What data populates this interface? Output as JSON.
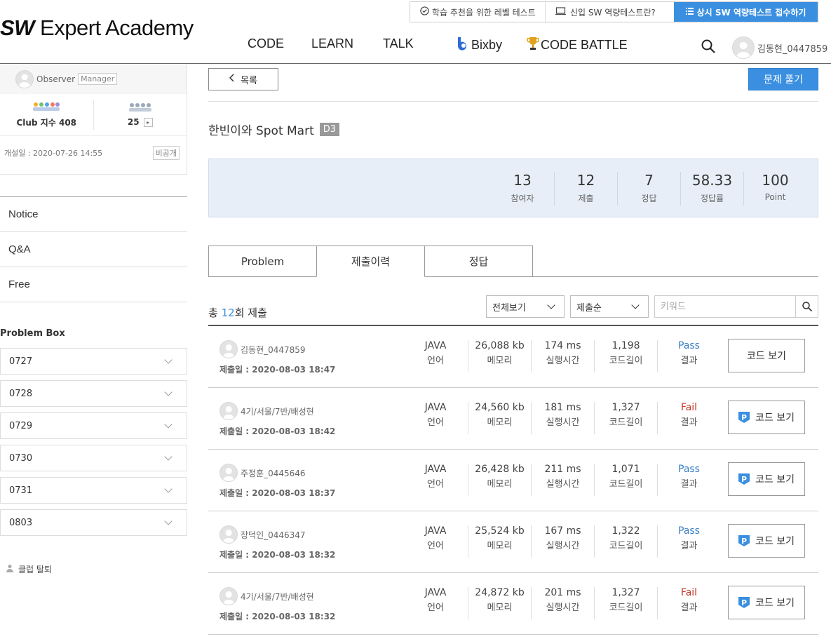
{
  "util": {
    "level_test": "학습 추천을 위한 레벨 테스트",
    "new_test": "신입 SW 역량테스트란?",
    "apply": "상시 SW 역량테스트 접수하기"
  },
  "logo": {
    "bold": "SW",
    "rest": " Expert Academy"
  },
  "nav": {
    "code": "CODE",
    "learn": "LEARN",
    "talk": "TALK",
    "bixby": "Bixby",
    "battle": "CODE BATTLE"
  },
  "user": {
    "name": "김동현_0447859"
  },
  "club": {
    "observer": "Observer",
    "manager_tag": "Manager",
    "club_index_label": "Club 지수",
    "club_index_value": "408",
    "members": "25",
    "opened": "개설일 : 2020-07-26 14:55",
    "private": "비공개"
  },
  "sidebar": {
    "links": [
      "Notice",
      "Q&A",
      "Free"
    ],
    "problem_box_title": "Problem Box",
    "boxes": [
      "0727",
      "0728",
      "0729",
      "0730",
      "0731",
      "0803"
    ],
    "leave": "클럽 탈퇴"
  },
  "main": {
    "back": "목록",
    "solve": "문제 풀기",
    "title": "한빈이와 Spot Mart",
    "level": "D3",
    "stats": [
      {
        "value": "13",
        "label": "참여자"
      },
      {
        "value": "12",
        "label": "제출"
      },
      {
        "value": "7",
        "label": "정답"
      },
      {
        "value": "58.33",
        "label": "정답률"
      },
      {
        "value": "100",
        "label": "Point"
      }
    ],
    "tabs": [
      "Problem",
      "제출이력",
      "정답"
    ],
    "count_prefix": "총",
    "count_value": "12",
    "count_suffix": "회 제출",
    "filter_all": "전체보기",
    "filter_order": "제출순",
    "keyword_placeholder": "키워드"
  },
  "labels": {
    "lang": "언어",
    "mem": "메모리",
    "time": "실행시간",
    "len": "코드길이",
    "result": "결과",
    "code_view": "코드 보기"
  },
  "submissions": [
    {
      "user": "김동현_0447859",
      "date": "제출일 : 2020-08-03 18:47",
      "lang": "JAVA",
      "mem": "26,088 kb",
      "time": "174 ms",
      "len": "1,198",
      "result": "Pass",
      "premium": false
    },
    {
      "user": "4기/서울/7반/배성현",
      "date": "제출일 : 2020-08-03 18:42",
      "lang": "JAVA",
      "mem": "24,560 kb",
      "time": "181 ms",
      "len": "1,327",
      "result": "Fail",
      "premium": true
    },
    {
      "user": "주정훈_0445646",
      "date": "제출일 : 2020-08-03 18:37",
      "lang": "JAVA",
      "mem": "26,428 kb",
      "time": "211 ms",
      "len": "1,071",
      "result": "Pass",
      "premium": true
    },
    {
      "user": "장덕인_0446347",
      "date": "제출일 : 2020-08-03 18:32",
      "lang": "JAVA",
      "mem": "25,524 kb",
      "time": "167 ms",
      "len": "1,322",
      "result": "Pass",
      "premium": true
    },
    {
      "user": "4기/서울/7반/배성현",
      "date": "제출일 : 2020-08-03 18:32",
      "lang": "JAVA",
      "mem": "24,872 kb",
      "time": "201 ms",
      "len": "1,327",
      "result": "Fail",
      "premium": true
    }
  ],
  "colors": {
    "accent": "#3a8fe0",
    "pass": "#3a7fc6",
    "fail": "#c0392b",
    "stats_bg": "#e7eef8"
  }
}
